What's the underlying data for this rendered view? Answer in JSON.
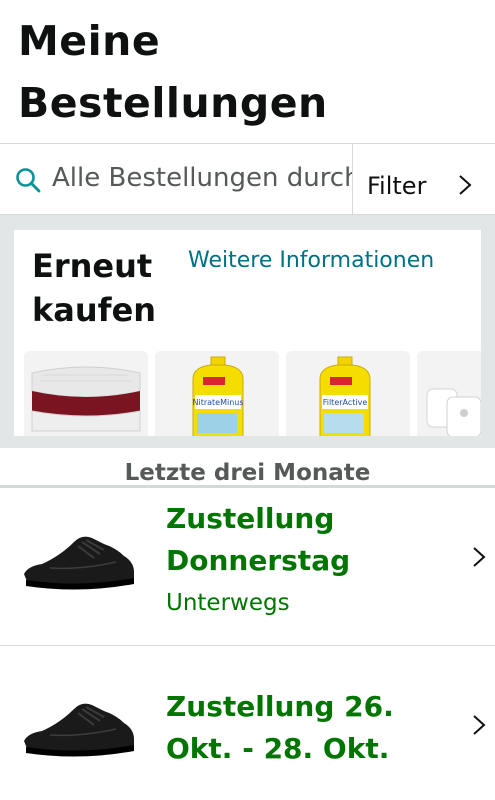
{
  "page": {
    "title_line1": "Meine",
    "title_line2": "Bestellungen"
  },
  "search": {
    "placeholder": "Alle Bestellungen durchsuchen",
    "filter_label": "Filter"
  },
  "buy_again": {
    "title": "Erneut kaufen",
    "more_info_link": "Weitere Informationen",
    "products": [
      {
        "name": "mattress-product",
        "icon": "mattress-image"
      },
      {
        "name": "tetra-nitrateminus-product",
        "icon": "bottle-image",
        "label": "NitrateMinus"
      },
      {
        "name": "tetra-filteractive-product",
        "icon": "bottle-image",
        "label": "FilterActive"
      },
      {
        "name": "smart-plug-product",
        "icon": "plug-image"
      }
    ]
  },
  "orders": {
    "section_label": "Letzte drei Monate",
    "items": [
      {
        "status": "Zustellung Donnerstag",
        "substatus": "Unterwegs",
        "icon": "black-sneaker-image"
      },
      {
        "status": "Zustellung 26. Okt. - 28. Okt.",
        "substatus": "",
        "icon": "black-sneaker-image"
      }
    ]
  },
  "colors": {
    "link": "#007185",
    "delivery_green": "#007600",
    "divider": "#d5d9d9",
    "muted_bg": "#e3e6e6"
  }
}
